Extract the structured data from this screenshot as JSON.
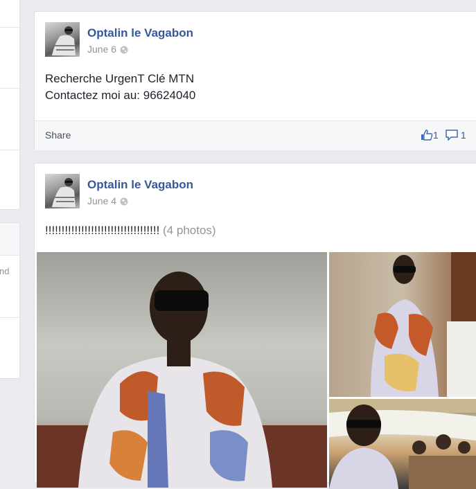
{
  "left_panel": {
    "snippet": "nd"
  },
  "posts": [
    {
      "author": "Optalin le Vagabon",
      "date": "June 6",
      "body_lines": [
        "Recherche UrgenT Clé MTN",
        "Contactez moi au: 96624040"
      ],
      "footer": {
        "share_label": "Share",
        "likes": "1",
        "comments": "1"
      }
    },
    {
      "author": "Optalin le Vagabon",
      "date": "June 4",
      "body": "!!!!!!!!!!!!!!!!!!!!!!!!!!!!!!!!!!!",
      "photos_label": "(4 photos)"
    }
  ],
  "icons": {
    "privacy": "globe-icon",
    "like": "thumbs-up-icon",
    "comment": "speech-bubble-icon"
  },
  "colors": {
    "author_link": "#365899",
    "meta_text": "#90949c",
    "background": "#e9ebee"
  }
}
